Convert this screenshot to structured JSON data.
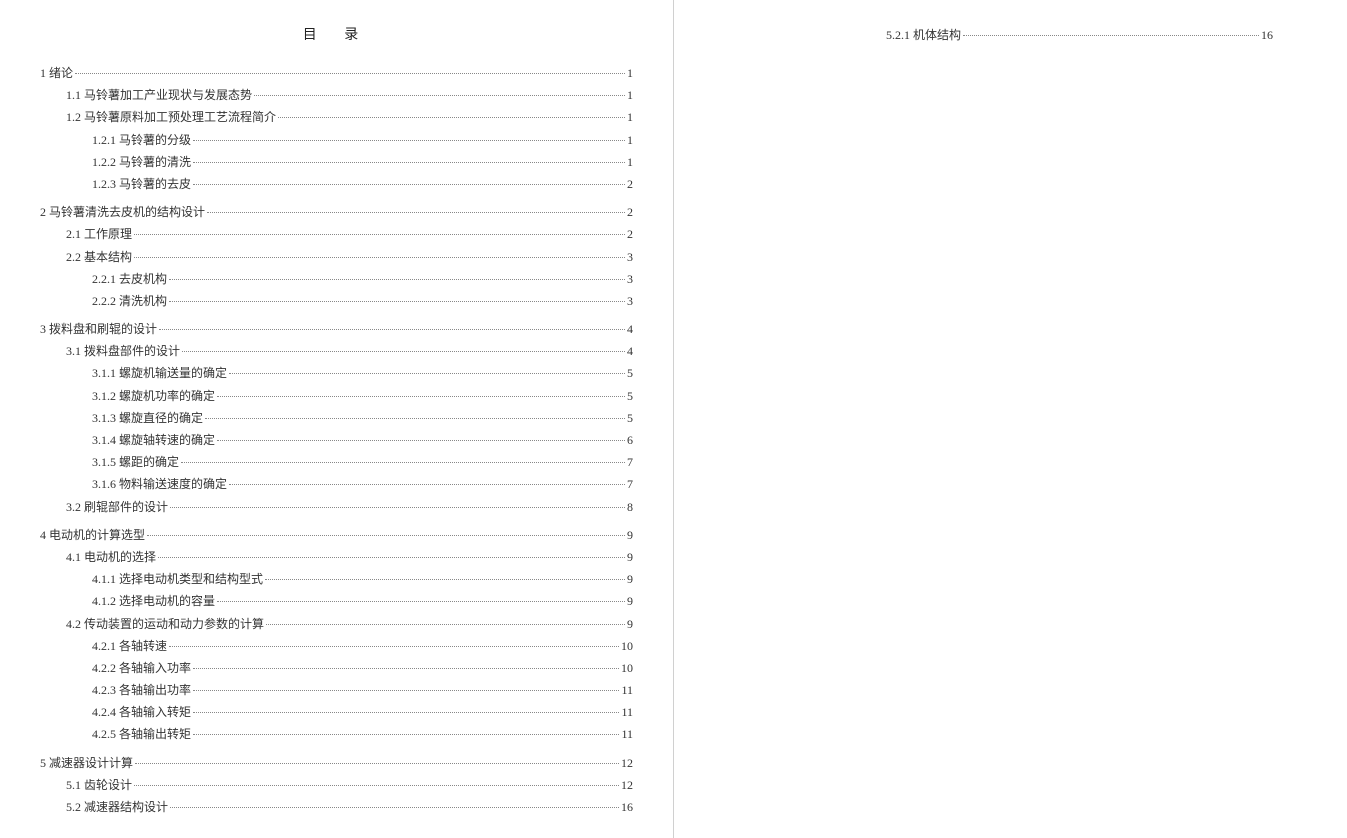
{
  "title": "目  录",
  "left_entries": [
    {
      "level": 1,
      "label": "1 绪论",
      "page": "1"
    },
    {
      "level": 2,
      "label": "1.1 马铃薯加工产业现状与发展态势",
      "page": "1"
    },
    {
      "level": 2,
      "label": "1.2 马铃薯原料加工预处理工艺流程简介",
      "page": "1"
    },
    {
      "level": 3,
      "label": "1.2.1  马铃薯的分级",
      "page": "1"
    },
    {
      "level": 3,
      "label": "1.2.2  马铃薯的清洗",
      "page": "1"
    },
    {
      "level": 3,
      "label": "1.2.3  马铃薯的去皮",
      "page": "2"
    },
    {
      "level": 1,
      "label": "2  马铃薯清洗去皮机的结构设计",
      "page": "2"
    },
    {
      "level": 2,
      "label": "2.1 工作原理",
      "page": "2"
    },
    {
      "level": 2,
      "label": "2.2 基本结构",
      "page": "3"
    },
    {
      "level": 3,
      "label": "2.2.1  去皮机构",
      "page": "3"
    },
    {
      "level": 3,
      "label": "2.2.2 清洗机构",
      "page": "3"
    },
    {
      "level": 1,
      "label": "3 拨料盘和刷辊的设计",
      "page": "4"
    },
    {
      "level": 2,
      "label": "3.1  拨料盘部件的设计",
      "page": "4"
    },
    {
      "level": 3,
      "label": "3.1.1 螺旋机输送量的确定",
      "page": "5"
    },
    {
      "level": 3,
      "label": "3.1.2 螺旋机功率的确定",
      "page": "5"
    },
    {
      "level": 3,
      "label": "3.1.3 螺旋直径的确定",
      "page": "5"
    },
    {
      "level": 3,
      "label": "3.1.4 螺旋轴转速的确定",
      "page": "6"
    },
    {
      "level": 3,
      "label": "3.1.5  螺距的确定",
      "page": "7"
    },
    {
      "level": 3,
      "label": "3.1.6  物料输送速度的确定",
      "page": "7"
    },
    {
      "level": 2,
      "label": "3.2  刷辊部件的设计",
      "page": "8"
    },
    {
      "level": 1,
      "label": "4 电动机的计算选型",
      "page": "9"
    },
    {
      "level": 2,
      "label": "4.1  电动机的选择",
      "page": "9"
    },
    {
      "level": 3,
      "label": "4.1.1  选择电动机类型和结构型式",
      "page": "9"
    },
    {
      "level": 3,
      "label": "4.1.2 选择电动机的容量",
      "page": "9"
    },
    {
      "level": 2,
      "label": "4.2   传动装置的运动和动力参数的计算",
      "page": "9"
    },
    {
      "level": 3,
      "label": "4.2.1  各轴转速",
      "page": "10"
    },
    {
      "level": 3,
      "label": "4.2.2 各轴输入功率",
      "page": "10"
    },
    {
      "level": 3,
      "label": "4.2.3 各轴输出功率",
      "page": "11"
    },
    {
      "level": 3,
      "label": "4.2.4 各轴输入转矩",
      "page": "11"
    },
    {
      "level": 3,
      "label": "4.2.5 各轴输出转矩",
      "page": "11"
    },
    {
      "level": 1,
      "label": "5 减速器设计计算",
      "page": "12"
    },
    {
      "level": 2,
      "label": "5.1 齿轮设计",
      "page": "12"
    },
    {
      "level": 2,
      "label": "5.2  减速器结构设计",
      "page": "16"
    }
  ],
  "right_entries": [
    {
      "level": 3,
      "label": "5.2.1 机体结构",
      "page": "16"
    }
  ]
}
